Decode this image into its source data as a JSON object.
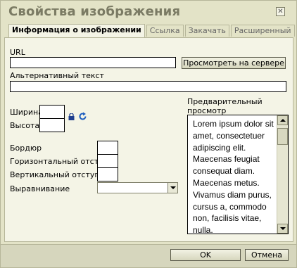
{
  "dialog": {
    "title": "Свойства изображения",
    "close_glyph": "✕"
  },
  "tabs": [
    {
      "label": "Информация о изображении",
      "active": true
    },
    {
      "label": "Ссылка",
      "active": false
    },
    {
      "label": "Закачать",
      "active": false
    },
    {
      "label": "Расширенный",
      "active": false
    }
  ],
  "form": {
    "url_label": "URL",
    "url_value": "",
    "browse_button": "Просмотреть на сервере",
    "alt_label": "Альтернативный текст",
    "alt_value": "",
    "width_label": "Ширина",
    "width_value": "",
    "height_label": "Высота",
    "height_value": "",
    "border_label": "Бордюр",
    "border_value": "",
    "hspace_label": "Горизонтальный отступ",
    "hspace_value": "",
    "vspace_label": "Вертикальный отступ",
    "vspace_value": "",
    "align_label": "Выравнивание",
    "align_value": ""
  },
  "preview": {
    "label": "Предварительный просмотр",
    "text": "Lorem ipsum dolor sit amet, consectetuer adipiscing elit. Maecenas feugiat consequat diam. Maecenas metus. Vivamus diam purus, cursus a, commodo non, facilisis vitae, nulla."
  },
  "footer": {
    "ok_button": "OK",
    "cancel_button": "Отмена"
  },
  "colors": {
    "dialog_bg": "#e3e3c7",
    "panel_bg": "#f4f4e6",
    "title_color": "#7b7b64",
    "footer_bg": "#d6d6bd"
  },
  "icons": {
    "lock": "lock-icon",
    "reset_size": "reset-size-icon",
    "close": "close-icon"
  }
}
